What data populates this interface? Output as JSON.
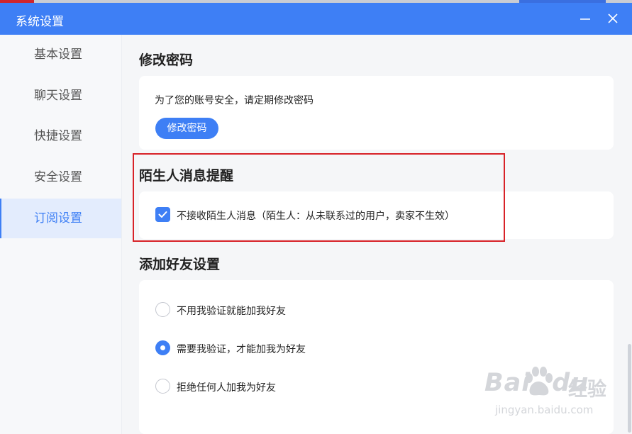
{
  "window": {
    "title": "系统设置",
    "accent_color": "#3e7ff5",
    "minimize_icon": "minimize-icon",
    "close_icon": "close-icon"
  },
  "sidebar": {
    "items": [
      {
        "label": "基本设置",
        "active": false
      },
      {
        "label": "聊天设置",
        "active": false
      },
      {
        "label": "快捷设置",
        "active": false
      },
      {
        "label": "安全设置",
        "active": false
      },
      {
        "label": "订阅设置",
        "active": true
      }
    ]
  },
  "password": {
    "title": "修改密码",
    "description": "为了您的账号安全，请定期修改密码",
    "button_label": "修改密码"
  },
  "stranger": {
    "title": "陌生人消息提醒",
    "option_label": "不接收陌生人消息（陌生人：从未联系过的用户，卖家不生效）",
    "checked": true,
    "highlight_color": "#d82228"
  },
  "friend": {
    "title": "添加好友设置",
    "options": [
      {
        "label": "不用我验证就能加我好友",
        "selected": false
      },
      {
        "label": "需要我验证，才能加我为好友",
        "selected": true
      },
      {
        "label": "拒绝任何人加我为好友",
        "selected": false
      }
    ]
  },
  "watermark": {
    "brand": "Bai",
    "brand_suffix": "du",
    "jingyan": "经验",
    "url": "jingyan.baidu.com"
  }
}
